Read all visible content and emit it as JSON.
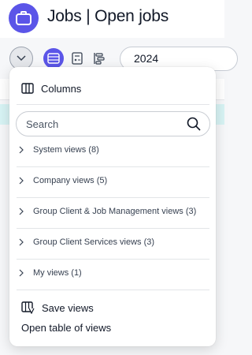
{
  "header": {
    "title": "Jobs | Open jobs",
    "icon": "briefcase-icon"
  },
  "toolbar": {
    "year_value": "2024",
    "accent": "#5b55e8"
  },
  "menu": {
    "columns_label": "Columns",
    "search_placeholder": "Search",
    "groups": [
      {
        "label": "System views (8)"
      },
      {
        "label": "Company views (5)"
      },
      {
        "label": "Group Client & Job Management views (3)"
      },
      {
        "label": "Group Client Services views (3)"
      },
      {
        "label": "My views (1)"
      }
    ],
    "save_label": "Save views",
    "open_table_label": "Open table of views"
  }
}
